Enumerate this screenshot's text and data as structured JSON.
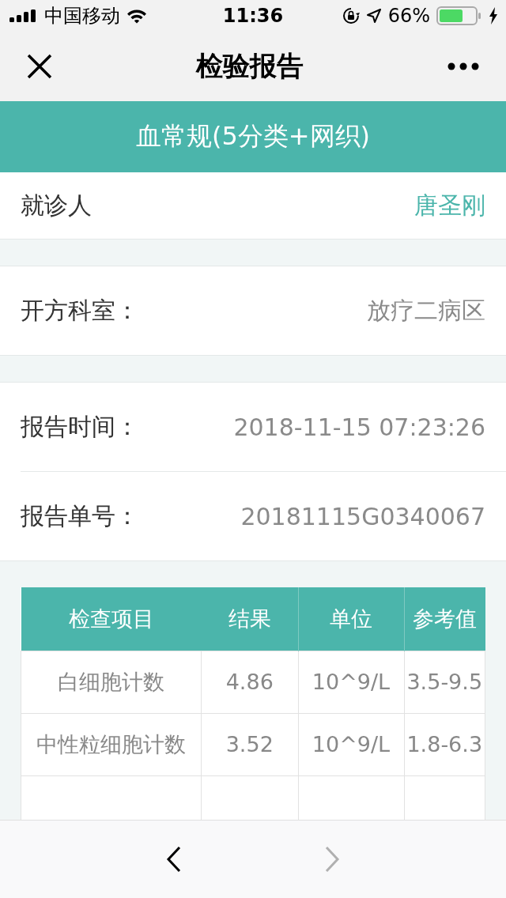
{
  "status_bar": {
    "carrier": "中国移动",
    "time": "11:36",
    "battery": "66%"
  },
  "nav": {
    "title": "检验报告"
  },
  "banner": {
    "title": "血常规(5分类+网织)"
  },
  "patient": {
    "label": "就诊人",
    "value": "唐圣刚"
  },
  "department": {
    "label": "开方科室：",
    "value": "放疗二病区"
  },
  "report_info": [
    {
      "label": "报告时间：",
      "value": "2018-11-15 07:23:26"
    },
    {
      "label": "报告单号：",
      "value": "20181115G0340067"
    }
  ],
  "table": {
    "columns": [
      "检查项目",
      "结果",
      "单位",
      "参考值"
    ],
    "rows": [
      [
        "白细胞计数",
        "4.86",
        "10^9/L",
        "3.5-9.5"
      ],
      [
        "中性粒细胞计数",
        "3.52",
        "10^9/L",
        "1.8-6.3"
      ]
    ]
  },
  "toolbar": {
    "back": {
      "disabled": false
    },
    "forward": {
      "disabled": true
    }
  }
}
